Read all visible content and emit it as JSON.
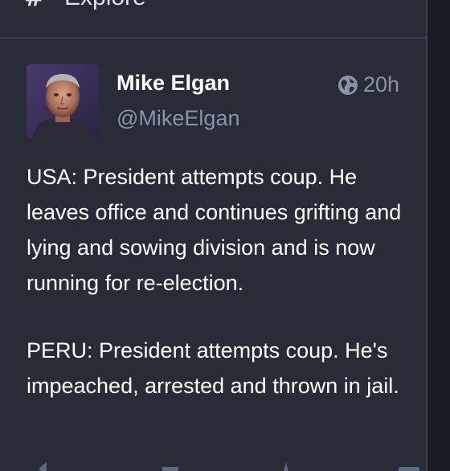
{
  "header": {
    "icon": "#",
    "title": "Explore"
  },
  "status": {
    "display_name": "Mike Elgan",
    "username": "@MikeElgan",
    "timestamp": "20h",
    "visibility_icon": "globe-icon",
    "paragraphs": [
      "USA: President attempts coup. He leaves office and continues grifting and lying and sowing division and is now running for re-election.",
      "PERU: President attempts coup. He's impeached, arrested and thrown in jail."
    ]
  },
  "actions": [
    "reply-icon",
    "boost-icon",
    "favourite-icon",
    "bookmark-icon",
    "more-icon"
  ],
  "colors": {
    "background": "#282c37",
    "outer": "#191b22",
    "text": "#ffffff",
    "muted": "#8a93a8"
  }
}
